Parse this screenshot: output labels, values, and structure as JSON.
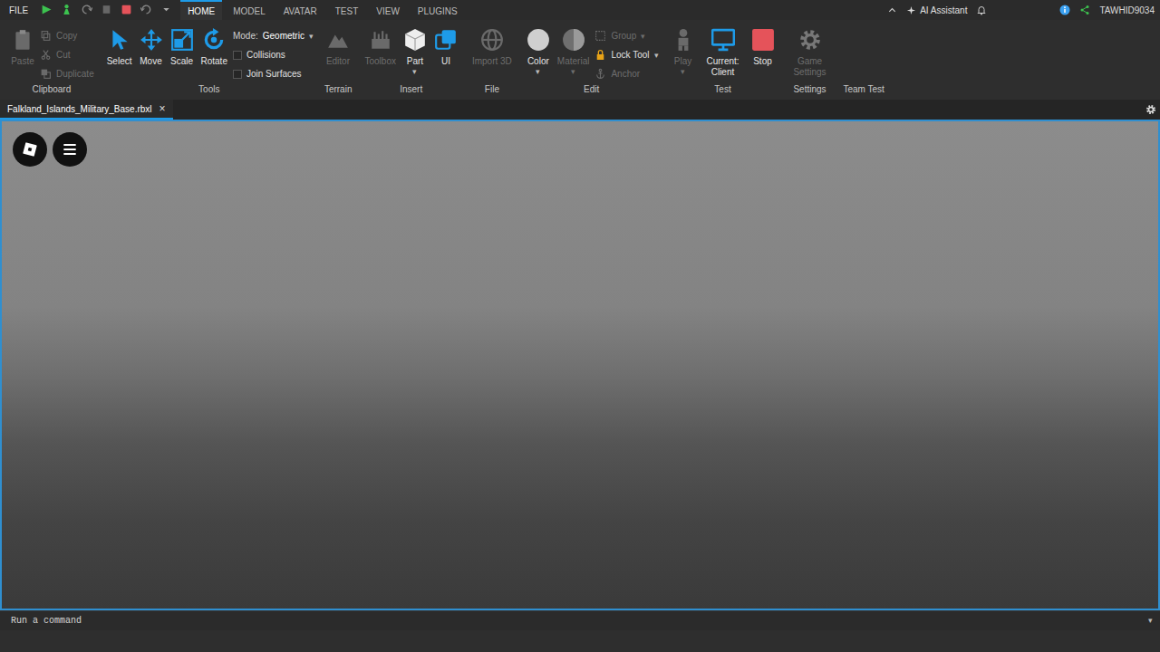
{
  "menu_bar": {
    "file": "FILE",
    "tabs": [
      {
        "label": "HOME",
        "selected": true
      },
      {
        "label": "MODEL",
        "selected": false
      },
      {
        "label": "AVATAR",
        "selected": false
      },
      {
        "label": "TEST",
        "selected": false
      },
      {
        "label": "VIEW",
        "selected": false
      },
      {
        "label": "PLUGINS",
        "selected": false
      }
    ],
    "assistant": "AI Assistant",
    "user": "TAWHID9034"
  },
  "ribbon": {
    "groups": [
      {
        "label": "Clipboard",
        "items": [
          {
            "kind": "big",
            "label": "Paste",
            "disabled": true
          },
          {
            "kind": "small",
            "label": "Copy",
            "disabled": true
          },
          {
            "kind": "small",
            "label": "Cut",
            "disabled": true
          },
          {
            "kind": "small",
            "label": "Duplicate",
            "disabled": true
          }
        ]
      },
      {
        "label": "Tools",
        "items": [
          {
            "kind": "big",
            "label": "Select",
            "disabled": false
          },
          {
            "kind": "big",
            "label": "Move",
            "disabled": false
          },
          {
            "kind": "big",
            "label": "Scale",
            "disabled": false
          },
          {
            "kind": "big",
            "label": "Rotate",
            "disabled": false
          },
          {
            "kind": "dropdown",
            "label": "Mode:",
            "value": "Geometric",
            "caret": "▾",
            "disabled": false
          },
          {
            "kind": "check",
            "label": "Collisions",
            "checked": false,
            "disabled": false
          },
          {
            "kind": "check",
            "label": "Join Surfaces",
            "checked": false,
            "disabled": false
          }
        ]
      },
      {
        "label": "Terrain",
        "items": [
          {
            "kind": "big",
            "label": "Editor",
            "disabled": true
          }
        ]
      },
      {
        "label": "Insert",
        "items": [
          {
            "kind": "big",
            "label": "Toolbox",
            "disabled": true
          },
          {
            "kind": "big",
            "label": "Part",
            "caret": "▾",
            "disabled": false
          },
          {
            "kind": "big",
            "label": "UI",
            "disabled": false
          }
        ]
      },
      {
        "label": "File",
        "items": [
          {
            "kind": "big",
            "label": "Import 3D",
            "disabled": true
          }
        ]
      },
      {
        "label": "Edit",
        "items": [
          {
            "kind": "big",
            "label": "Color",
            "caret": "▾",
            "disabled": false
          },
          {
            "kind": "big",
            "label": "Material",
            "caret": "▾",
            "disabled": true
          },
          {
            "kind": "small",
            "label": "Group",
            "caret": "▾",
            "disabled": true
          },
          {
            "kind": "small",
            "label": "Lock Tool",
            "caret": "▾",
            "disabled": false
          },
          {
            "kind": "small",
            "label": "Anchor",
            "disabled": true
          }
        ]
      },
      {
        "label": "Test",
        "items": [
          {
            "kind": "big",
            "label": "Play",
            "caret": "▾",
            "disabled": true
          },
          {
            "kind": "big",
            "label": "Current: Client",
            "disabled": false
          },
          {
            "kind": "big",
            "label": "Stop",
            "disabled": false
          }
        ]
      },
      {
        "label": "Settings",
        "items": [
          {
            "kind": "big",
            "label": "Game Settings",
            "disabled": true
          }
        ]
      },
      {
        "label": "Team Test",
        "items": []
      }
    ]
  },
  "document_tab": {
    "title": "Falkland_Islands_Military_Base.rbxl",
    "close": "×",
    "selected": true
  },
  "command_bar": {
    "placeholder": "Run a command",
    "caret": "▾"
  }
}
